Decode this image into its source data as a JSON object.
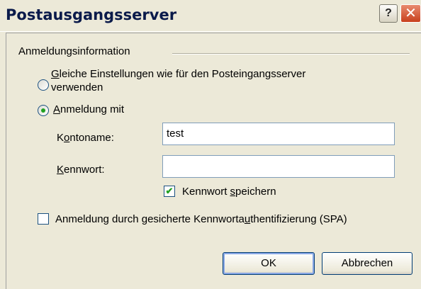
{
  "window": {
    "title": "Postausgangsserver",
    "help_glyph": "?",
    "close_glyph": "✕"
  },
  "group": {
    "label": "Anmeldungsinformation"
  },
  "options": {
    "same_settings_line1_ul": "G",
    "same_settings_line1_rest": "leiche Einstellungen wie für den Posteingangsserver",
    "same_settings_line2": "verwenden",
    "login_with_ul": "A",
    "login_with_rest": "nmeldung mit"
  },
  "fields": {
    "account_label_pre": "K",
    "account_label_ul": "o",
    "account_label_rest": "ntoname:",
    "account_value": "test",
    "password_label_ul": "K",
    "password_label_rest": "ennwort:",
    "password_value": ""
  },
  "save_password": {
    "pre": "Kennwort ",
    "ul": "s",
    "rest": "peichern",
    "checked": true
  },
  "spa": {
    "pre": "Anmeldung durch gesicherte Kennworta",
    "ul": "u",
    "rest": "thentifizierung (SPA)",
    "checked": false
  },
  "buttons": {
    "ok": "OK",
    "cancel": "Abbrechen"
  }
}
